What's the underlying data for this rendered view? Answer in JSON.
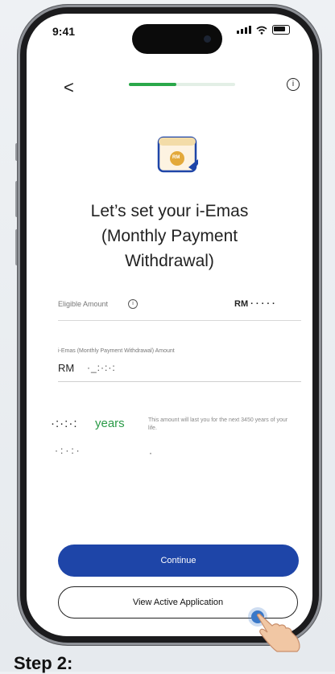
{
  "status_bar": {
    "time": "9:41"
  },
  "nav": {
    "back_glyph": "<",
    "info_glyph": "i",
    "progress": 0.45
  },
  "hero": {
    "icon": "rm-coin-document-icon",
    "coin_text": "RM"
  },
  "heading": {
    "line1": "Let’s set your i-Emas",
    "line2": "(Monthly Payment",
    "line3": "Withdrawal)"
  },
  "eligible": {
    "label": "Eligible Amount",
    "info_glyph": "i",
    "value": "RM · · · · ·"
  },
  "withdrawal_input": {
    "label": "i-Emas (Monthly Payment Withdrawal) Amount",
    "currency": "RM",
    "value": "·_:·:·:"
  },
  "duration": {
    "number": "·:·:·:",
    "unit": "years",
    "note": "This amount will last you for the next 3450 years of your life.",
    "dots_left": "·:·:·",
    "dot_mid": "·"
  },
  "buttons": {
    "continue": "Continue",
    "view_active": "View Active Application"
  },
  "caption": "Step 2:",
  "colors": {
    "primary": "#1e45a8",
    "accent_green": "#2aa84a",
    "tap_indicator": "#3a78c8"
  }
}
